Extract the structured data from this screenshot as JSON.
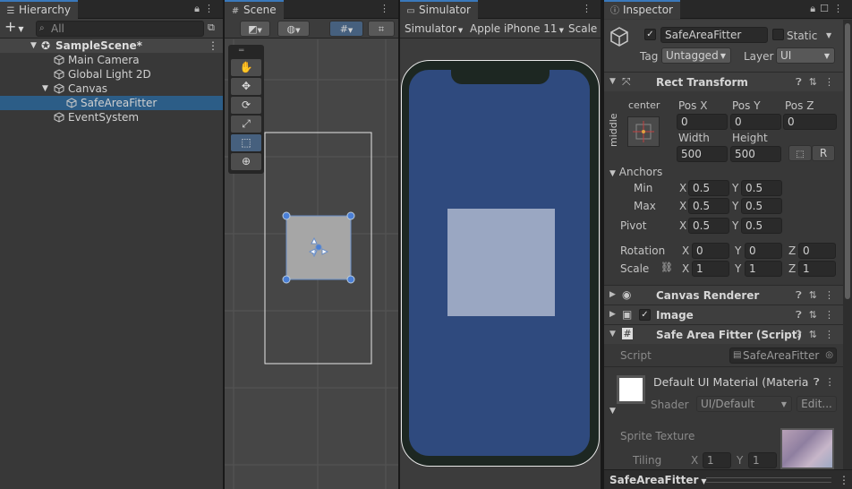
{
  "hierarchy": {
    "tab_label": "Hierarchy",
    "add_label": "+",
    "search_placeholder": "All",
    "scene_name": "SampleScene*",
    "items": [
      {
        "label": "Main Camera",
        "depth": 1
      },
      {
        "label": "Global Light 2D",
        "depth": 1
      },
      {
        "label": "Canvas",
        "depth": 1
      },
      {
        "label": "SafeAreaFitter",
        "depth": 2,
        "selected": true
      },
      {
        "label": "EventSystem",
        "depth": 1
      }
    ]
  },
  "scene": {
    "tab_label": "Scene"
  },
  "simulator": {
    "tab_label": "Simulator",
    "mode_label": "Simulator",
    "device_label": "Apple iPhone 11",
    "scale_label": "Scale"
  },
  "inspector": {
    "tab_label": "Inspector",
    "object_name": "SafeAreaFitter",
    "static_label": "Static",
    "tag_label": "Tag",
    "tag_value": "Untagged",
    "layer_label": "Layer",
    "layer_value": "UI",
    "rect_transform": {
      "title": "Rect Transform",
      "anchor_h": "center",
      "anchor_v": "middle",
      "pos_x_label": "Pos X",
      "pos_x": "0",
      "pos_y_label": "Pos Y",
      "pos_y": "0",
      "pos_z_label": "Pos Z",
      "pos_z": "0",
      "width_label": "Width",
      "width": "500",
      "height_label": "Height",
      "height": "500",
      "raw_label": "R",
      "anchors_label": "Anchors",
      "min_label": "Min",
      "min_x": "0.5",
      "min_y": "0.5",
      "max_label": "Max",
      "max_x": "0.5",
      "max_y": "0.5",
      "pivot_label": "Pivot",
      "pivot_x": "0.5",
      "pivot_y": "0.5",
      "rotation_label": "Rotation",
      "rot_x": "0",
      "rot_y": "0",
      "rot_z": "0",
      "scale_label": "Scale",
      "scale_x": "1",
      "scale_y": "1",
      "scale_z": "1",
      "x": "X",
      "y": "Y",
      "z": "Z"
    },
    "canvas_renderer_title": "Canvas Renderer",
    "image_title": "Image",
    "safe_area_title": "Safe Area Fitter (Script)",
    "script_label": "Script",
    "script_value": "SafeAreaFitter",
    "material_name": "Default UI Material (Materia",
    "shader_label": "Shader",
    "shader_value": "UI/Default",
    "edit_label": "Edit...",
    "sprite_texture_label": "Sprite Texture",
    "tiling_label": "Tiling",
    "tiling_x": "1",
    "tiling_y": "1",
    "footer_label": "SafeAreaFitter"
  },
  "colors": {
    "accent": "#3a79bb",
    "selection": "#2c5d87",
    "device_screen": "#2f4a7e",
    "device_frame": "#1e2620",
    "safe_area": "#9aa7c2"
  }
}
